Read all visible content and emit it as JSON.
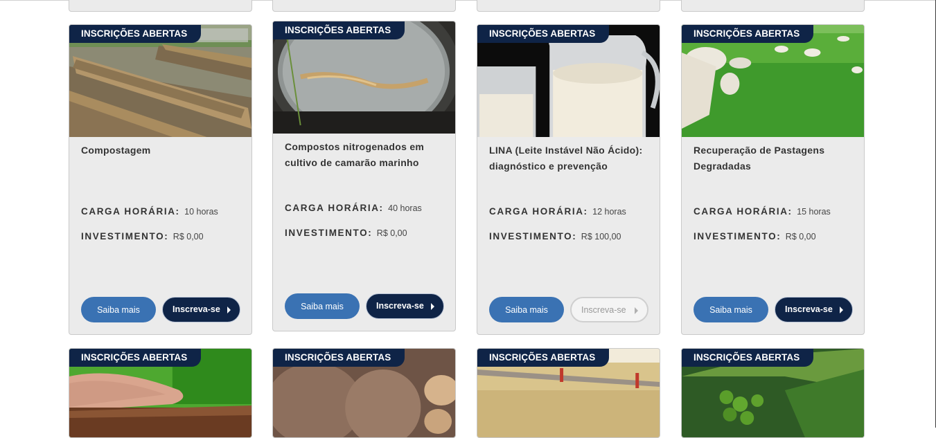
{
  "badge_label": "INSCRIÇÕES ABERTAS",
  "labels": {
    "carga_horaria": "CARGA HORÁRIA:",
    "investimento": "INVESTIMENTO:",
    "saiba_mais": "Saiba mais",
    "inscreva_se": "Inscreva-se"
  },
  "courses": [
    {
      "title": "Compostagem",
      "carga_horaria": "10 horas",
      "investimento": "R$ 0,00",
      "enrollment_enabled": true
    },
    {
      "title": "Compostos nitrogenados em cultivo de camarão marinho",
      "carga_horaria": "40 horas",
      "investimento": "R$ 0,00",
      "enrollment_enabled": true
    },
    {
      "title": "LINA (Leite Instável Não Ácido): diagnóstico e prevenção",
      "carga_horaria": "12 horas",
      "investimento": "R$ 100,00",
      "enrollment_enabled": false
    },
    {
      "title": "Recuperação de Pastagens Degradadas",
      "carga_horaria": "15 horas",
      "investimento": "R$ 0,00",
      "enrollment_enabled": true
    }
  ],
  "colors": {
    "badge_bg": "#0f2447",
    "saiba_button": "#3a72b3",
    "inscreva_button": "#0f2447",
    "card_bg": "#ebebeb"
  }
}
